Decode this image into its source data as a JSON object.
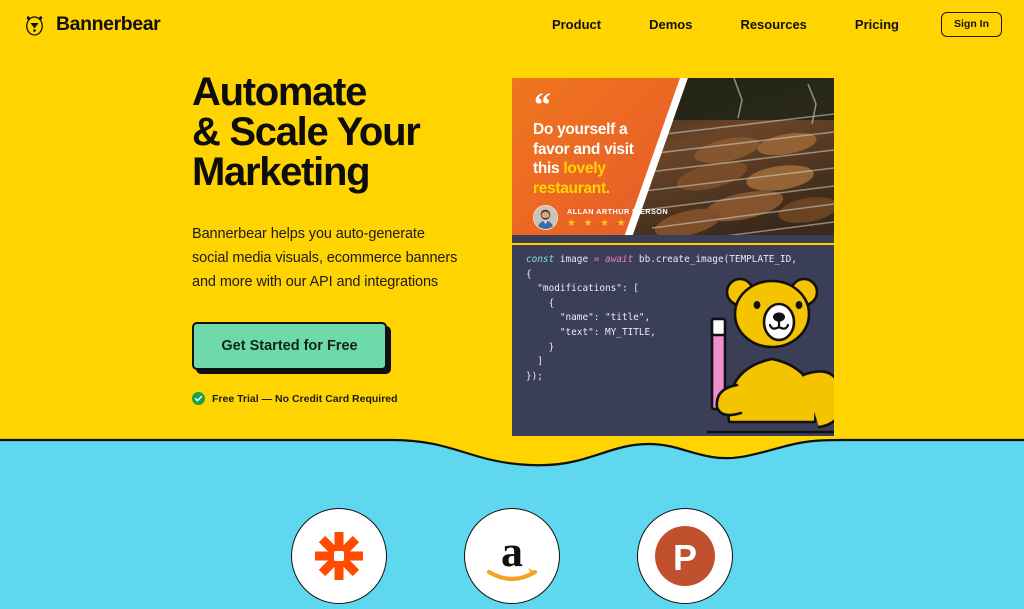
{
  "theme": {
    "bg_yellow": "#FFD400",
    "bg_blue": "#5FD7EE",
    "accent_green": "#6ED9A9",
    "accent_orange": "#EE6B23",
    "code_bg": "#3A3E57",
    "ink": "#111111"
  },
  "header": {
    "brand_name": "Bannerbear",
    "brand_icon": "bear-head-icon",
    "nav": [
      {
        "label": "Product"
      },
      {
        "label": "Demos"
      },
      {
        "label": "Resources"
      },
      {
        "label": "Pricing"
      }
    ],
    "signin_label": "Sign In"
  },
  "hero": {
    "title": "Automate\n& Scale Your\nMarketing",
    "subtitle": "Bannerbear helps you auto-generate\nsocial media visuals, ecommerce banners\nand more with our API and integrations",
    "cta_label": "Get Started for Free",
    "trial_note": "Free Trial — No Credit Card Required",
    "trial_icon": "check-circle-icon"
  },
  "banner_preview": {
    "quote_icon": "quote-mark-icon",
    "quote_line1": "Do yourself a",
    "quote_line2": "favor and visit",
    "quote_line3_plain": "this ",
    "quote_line3_highlight": "lovely",
    "quote_line4_highlight": "restaurant.",
    "author_name": "ALLAN ARTHUR IVERSON",
    "author_avatar": "avatar-photo",
    "rating_stars": "★ ★ ★ ★",
    "rating_value": 4,
    "photo_alt": "grilled-meat-photo"
  },
  "code_snippet": {
    "line1_kw": "const",
    "line1_mid": " image ",
    "line1_eq": "=",
    "line1_await": " await",
    "line1_rest": " bb.create_image(TEMPLATE_ID,",
    "line2": "{",
    "line3": "  \"modifications\": [",
    "line4": "    {",
    "line5": "      \"name\": \"title\",",
    "line6": "      \"text\": MY_TITLE,",
    "line7": "    }",
    "line8": "  ]",
    "line9": "});",
    "mascot": "bannerbear-mascot-bear-with-marker"
  },
  "logos": [
    {
      "name": "zapier-logo",
      "color": "#FF4A00"
    },
    {
      "name": "amazon-logo",
      "color": "#111111"
    },
    {
      "name": "product-hunt-logo",
      "color": "#C0502E",
      "letter": "P"
    }
  ]
}
